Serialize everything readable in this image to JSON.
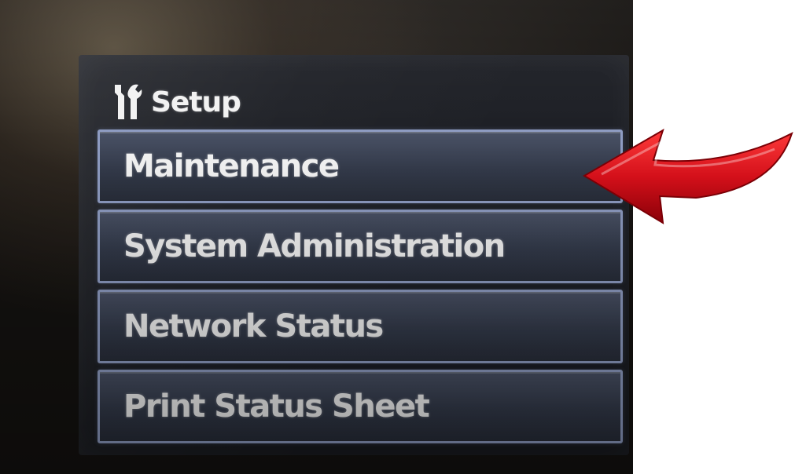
{
  "screen": {
    "title": "Setup",
    "title_icon": "wrench-icon"
  },
  "menu": {
    "items": [
      {
        "label": "Maintenance"
      },
      {
        "label": "System Administration"
      },
      {
        "label": "Network Status"
      },
      {
        "label": "Print Status Sheet"
      }
    ]
  },
  "annotation": {
    "arrow_icon": "red-arrow-icon",
    "arrow_color": "#d4101a",
    "points_to": "Maintenance"
  },
  "colors": {
    "item_border": "#8e9cc2",
    "item_fill": "#3a4152",
    "text": "#f4f4f4"
  }
}
